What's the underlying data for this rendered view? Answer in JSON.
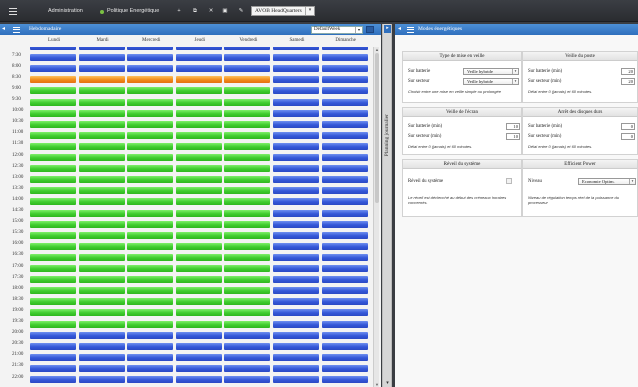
{
  "toolbar": {
    "admin_label": "Administration",
    "policy_label": "Politique Energétique",
    "plus_icon": "+",
    "copy_icon": "⧉",
    "delete_icon": "✕",
    "save_icon": "▣",
    "edit_icon": "✎",
    "site_select": "AVOB HeadQuarters",
    "arrow": "▾"
  },
  "weekly": {
    "title": "Hebdomadaire",
    "week_select": "DefaultWeek",
    "arrow": "▾",
    "days": [
      "Lundi",
      "Mardi",
      "Mercredi",
      "Jeudi",
      "Vendredi",
      "Samedi",
      "Dimanche"
    ],
    "times": [
      "7:00",
      "7:30",
      "8:00",
      "8:30",
      "9:00",
      "9:30",
      "10:00",
      "10:30",
      "11:00",
      "11:30",
      "12:00",
      "12:30",
      "13:00",
      "13:30",
      "14:00",
      "14:30",
      "15:00",
      "15:30",
      "16:00",
      "16:30",
      "17:00",
      "17:30",
      "18:00",
      "18:30",
      "19:00",
      "19:30",
      "20:00",
      "20:30",
      "21:00",
      "21:30",
      "22:00"
    ],
    "weekday_slots": [
      "blue",
      "blue",
      "blue",
      "orange",
      "green",
      "green",
      "green",
      "green",
      "green",
      "green",
      "green",
      "green",
      "green",
      "green",
      "green",
      "green",
      "green",
      "green",
      "green",
      "green",
      "green",
      "green",
      "green",
      "green",
      "green",
      "green",
      "blue",
      "blue",
      "blue",
      "blue",
      "blue"
    ],
    "weekend_slots": "blue"
  },
  "collapsed_panel": {
    "title": "Planning journalier",
    "arrow_right": "▸",
    "arrow_down": "▾"
  },
  "modes": {
    "title": "Modes énergétiques",
    "arrow_left": "◂",
    "sleep": {
      "title": "Type de mise en veille",
      "battery_label": "Sur batterie",
      "battery_value": "Veille hybride",
      "sector_label": "Sur secteur",
      "sector_value": "Veille hybride",
      "help": "Choisir entre une mise en veille simple ou prolongée"
    },
    "standby": {
      "title": "Veille du poste",
      "battery_label": "Sur batterie (min)",
      "battery_value": "20",
      "sector_label": "Sur secteur (min)",
      "sector_value": "20",
      "help": "Délai entre 0 (jamais) et 60 minutes."
    },
    "screen": {
      "title": "Veille de l'écran",
      "battery_label": "Sur batterie (min)",
      "battery_value": "10",
      "sector_label": "Sur secteur (min)",
      "sector_value": "10",
      "help": "Délai entre 0 (jamais) et 60 minutes."
    },
    "disks": {
      "title": "Arrêt des disques durs",
      "battery_label": "Sur batterie (min)",
      "battery_value": "0",
      "sector_label": "Sur secteur (min)",
      "sector_value": "0",
      "help": "Délai entre 0 (jamais) et 60 minutes."
    },
    "wake": {
      "title": "Réveil du système",
      "label": "Réveil du système",
      "help": "Le réveil est déclenché au début des créneaux horaires concernés."
    },
    "efficient": {
      "title": "Efficient Power",
      "label": "Niveau",
      "value": "Economie Optim.",
      "help": "Niveau de régulation temps réel de la puissance du processeur"
    }
  },
  "colors": {
    "accent": "#2f6fbd",
    "slot_blue": "#3457d8",
    "slot_green": "#3fcc2e",
    "slot_orange": "#f08a1a"
  }
}
